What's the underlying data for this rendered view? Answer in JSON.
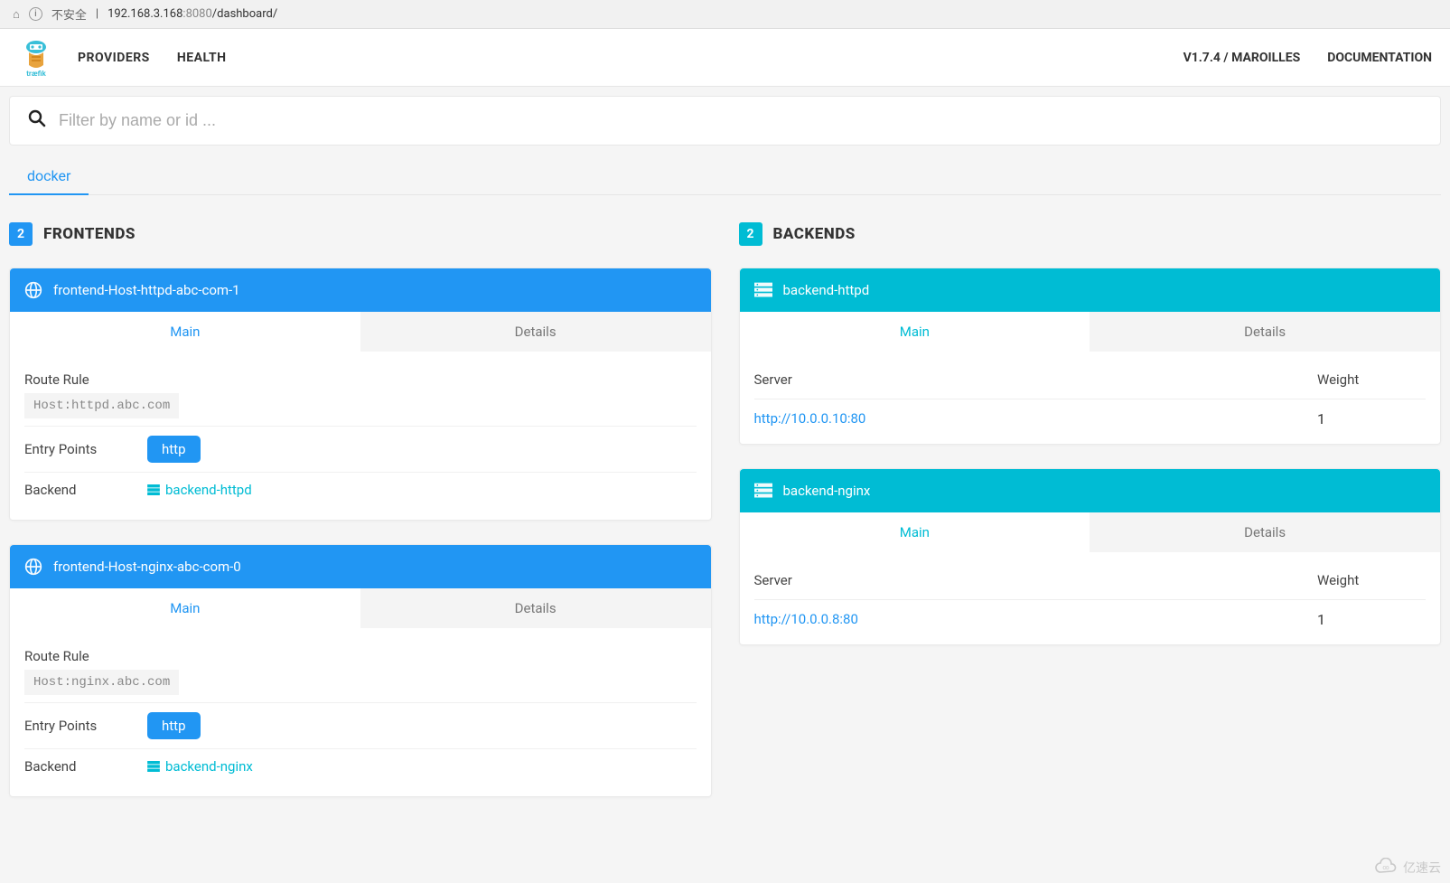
{
  "browser": {
    "security_label": "不安全",
    "url_host": "192.168.3.168",
    "url_port": ":8080",
    "url_path": "/dashboard/"
  },
  "nav": {
    "providers": "PROVIDERS",
    "health": "HEALTH",
    "version": "V1.7.4 / MAROILLES",
    "docs": "DOCUMENTATION"
  },
  "search": {
    "placeholder": "Filter by name or id ..."
  },
  "provider_tab": "docker",
  "frontends": {
    "count": "2",
    "title": "FRONTENDS",
    "tabs": {
      "main": "Main",
      "details": "Details"
    },
    "labels": {
      "route_rule": "Route Rule",
      "entry_points": "Entry Points",
      "backend": "Backend"
    },
    "items": [
      {
        "name": "frontend-Host-httpd-abc-com-1",
        "rule": "Host:httpd.abc.com",
        "entry": "http",
        "backend": "backend-httpd"
      },
      {
        "name": "frontend-Host-nginx-abc-com-0",
        "rule": "Host:nginx.abc.com",
        "entry": "http",
        "backend": "backend-nginx"
      }
    ]
  },
  "backends": {
    "count": "2",
    "title": "BACKENDS",
    "tabs": {
      "main": "Main",
      "details": "Details"
    },
    "labels": {
      "server": "Server",
      "weight": "Weight"
    },
    "items": [
      {
        "name": "backend-httpd",
        "server": "http://10.0.0.10:80",
        "weight": "1"
      },
      {
        "name": "backend-nginx",
        "server": "http://10.0.0.8:80",
        "weight": "1"
      }
    ]
  },
  "watermark": "亿速云"
}
